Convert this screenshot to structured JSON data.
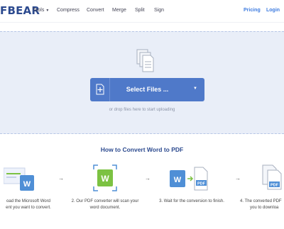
{
  "header": {
    "logo": "FBEAR",
    "nav": [
      {
        "label": "Tools",
        "has_caret": true
      },
      {
        "label": "Compress"
      },
      {
        "label": "Convert"
      },
      {
        "label": "Merge"
      },
      {
        "label": "Split"
      },
      {
        "label": "Sign"
      }
    ],
    "pricing": "Pricing",
    "login": "Login"
  },
  "upload": {
    "button_label": "Select Files ...",
    "hint": "or drop files here to start uploading"
  },
  "howto": {
    "title": "How to Convert Word to PDF",
    "steps": [
      {
        "line1": "oad the Microsoft Word",
        "line2": "ent you want to convert."
      },
      {
        "line1": "2. Our PDF converter will scan your",
        "line2": "word document."
      },
      {
        "line1": "3. Wait for the conversion to finish.",
        "line2": ""
      },
      {
        "line1": "4. The converted PDF",
        "line2": "you to downloa"
      }
    ],
    "icon_labels": {
      "word": "W",
      "pdf": "PDF"
    }
  },
  "colors": {
    "brand": "#2c4a8f",
    "accent": "#3d7be0",
    "button": "#4f79c9",
    "dropzone_bg": "#e9eef8",
    "word_green": "#7cc242"
  }
}
